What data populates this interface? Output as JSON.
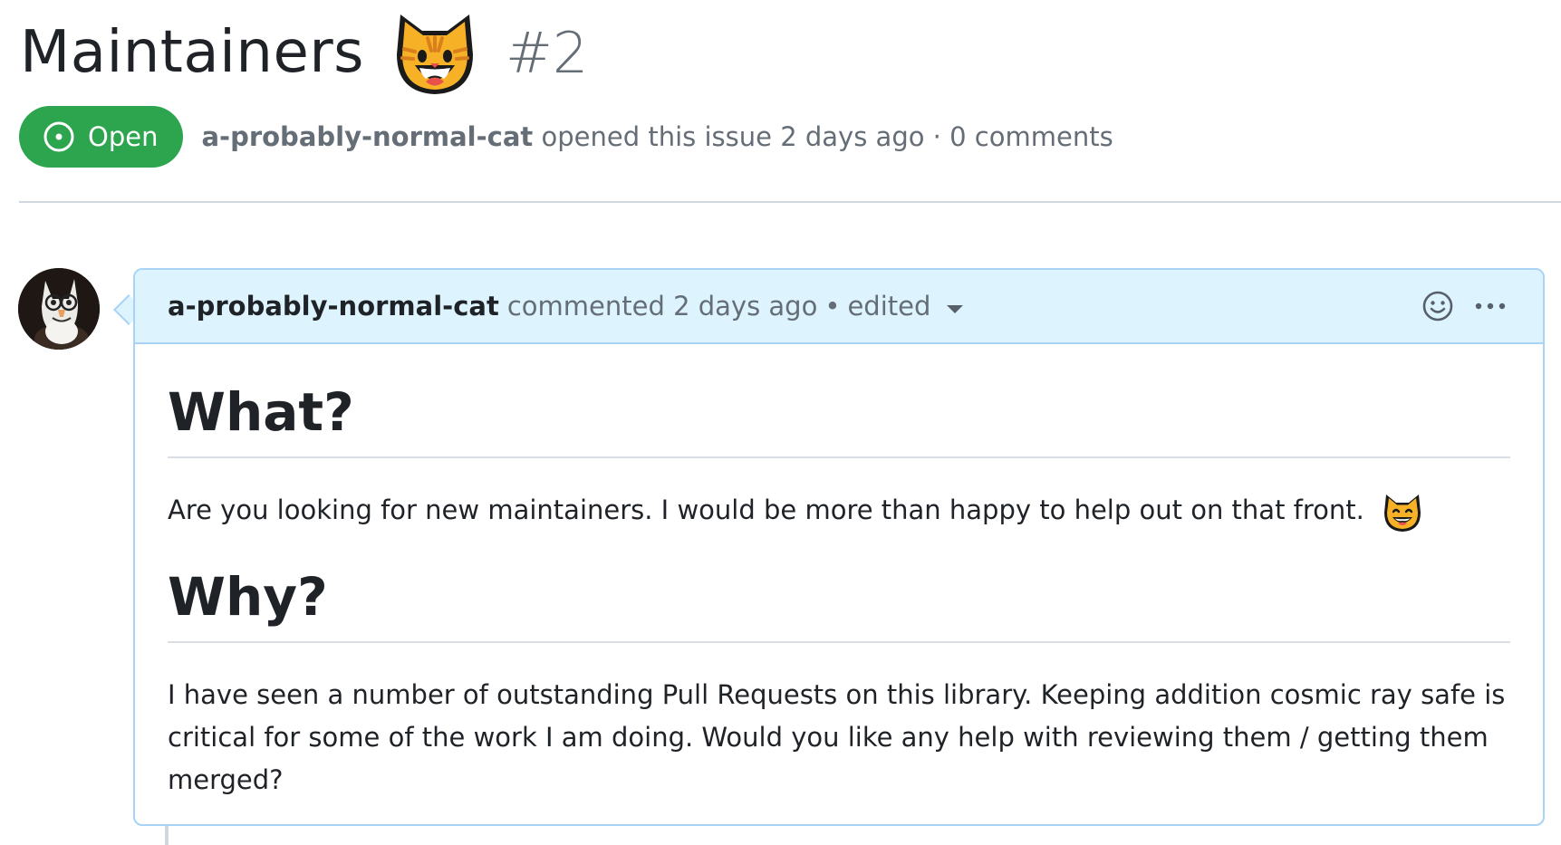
{
  "issue": {
    "title": "Maintainers",
    "title_emoji": "smiley-cat-emoji",
    "number": "#2",
    "state": "Open",
    "author": "a-probably-normal-cat",
    "opened_text": "opened this issue 2 days ago · 0 comments"
  },
  "comment": {
    "author": "a-probably-normal-cat",
    "action_text": "commented 2 days ago",
    "edited_text": "edited",
    "heading_1": "What?",
    "paragraph_1": "Are you looking for new maintainers. I would be more than happy to help out on that front.",
    "heading_2": "Why?",
    "paragraph_2": "I have seen a number of outstanding Pull Requests on this library. Keeping addition cosmic ray safe is critical for some of the work I am doing. Would you like any help with reviewing them / getting them merged?"
  },
  "colors": {
    "open_badge": "#2da44e",
    "comment_header_bg": "#ddf4ff",
    "comment_border": "#a8d3f5",
    "muted_text": "#656d76"
  },
  "icons": [
    "issue-opened-icon",
    "smiley-reaction-icon",
    "kebab-menu-icon",
    "dropdown-caret-icon"
  ]
}
